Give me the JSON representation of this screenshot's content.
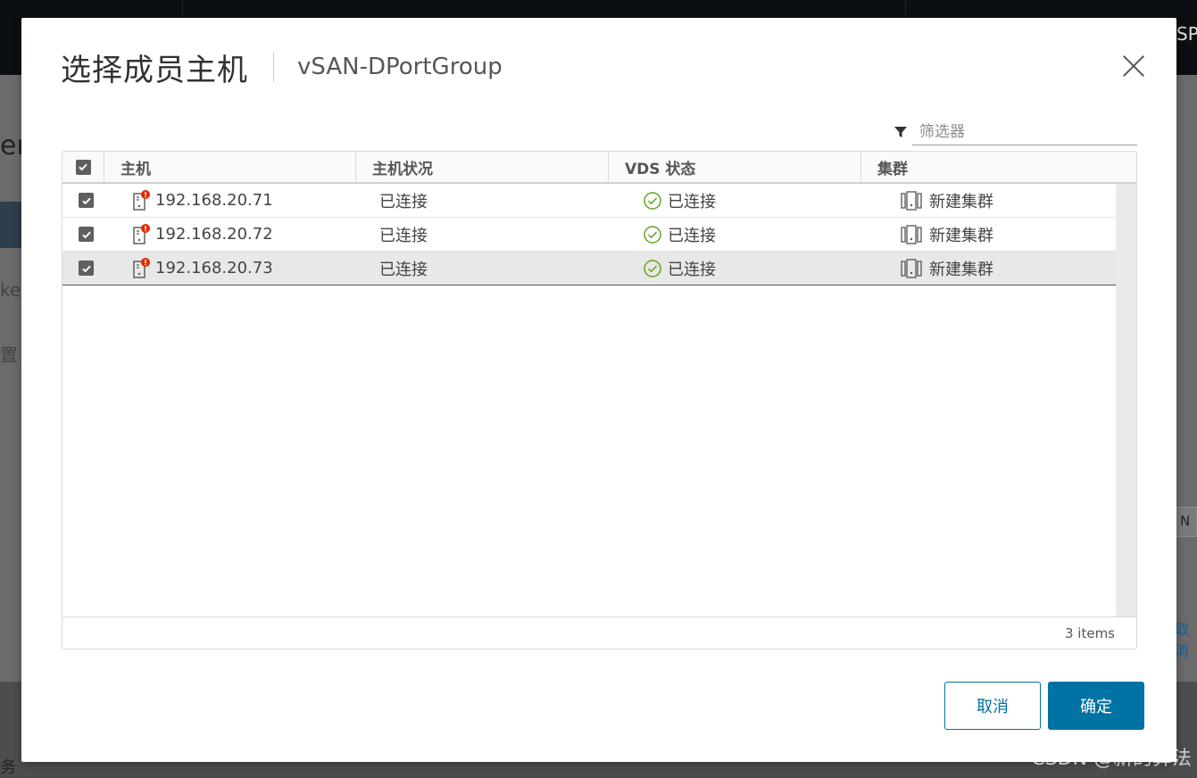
{
  "background": {
    "left_fragments": [
      "er",
      "ke",
      "置",
      "务"
    ],
    "right_link": "取消",
    "right_box_text": "N",
    "top_right_text": "SPL"
  },
  "dialog": {
    "title": "选择成员主机",
    "subtitle": "vSAN-DPortGroup",
    "filter_placeholder": "筛选器",
    "columns": [
      "主机",
      "主机状况",
      "VDS 状态",
      "集群"
    ],
    "rows": [
      {
        "host": "192.168.20.71",
        "host_state": "已连接",
        "vds_state": "已连接",
        "cluster": "新建集群",
        "checked": true,
        "selected": false
      },
      {
        "host": "192.168.20.72",
        "host_state": "已连接",
        "vds_state": "已连接",
        "cluster": "新建集群",
        "checked": true,
        "selected": false
      },
      {
        "host": "192.168.20.73",
        "host_state": "已连接",
        "vds_state": "已连接",
        "cluster": "新建集群",
        "checked": true,
        "selected": true
      }
    ],
    "footer_count": "3 items",
    "cancel_label": "取消",
    "ok_label": "确定"
  },
  "watermark": "CSDN @新的算法",
  "colors": {
    "primary": "#0072a3",
    "ok_green": "#62a420",
    "alert_red": "#e62700"
  }
}
